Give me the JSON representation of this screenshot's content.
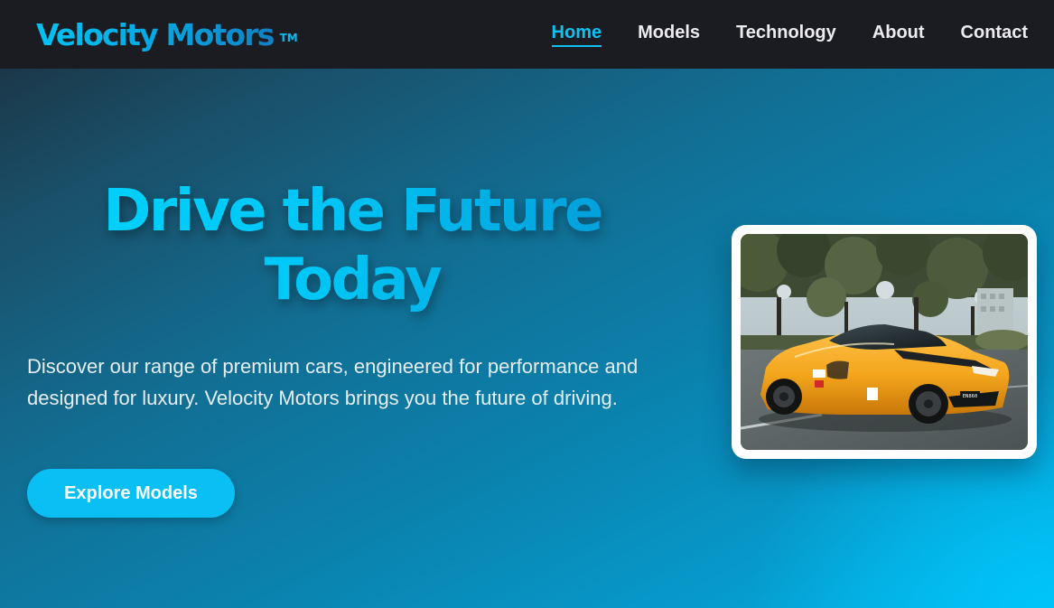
{
  "brand": {
    "name": "Velocity Motors",
    "trademark": "TM"
  },
  "nav": {
    "items": [
      {
        "label": "Home",
        "active": true
      },
      {
        "label": "Models",
        "active": false
      },
      {
        "label": "Technology",
        "active": false
      },
      {
        "label": "About",
        "active": false
      },
      {
        "label": "Contact",
        "active": false
      }
    ]
  },
  "hero": {
    "title_line1": "Drive the Future",
    "title_line2": "Today",
    "description": "Discover our range of premium cars, engineered for performance and designed for luxury. Velocity Motors brings you the future of driving.",
    "cta_label": "Explore Models"
  },
  "colors": {
    "accent": "#0ec1f2",
    "nav_background": "#1b1c21",
    "button": "#0abff4",
    "car_body": "#f4a51c"
  },
  "image": {
    "subject": "orange-sports-car-photo",
    "plate_text": "EN860"
  }
}
